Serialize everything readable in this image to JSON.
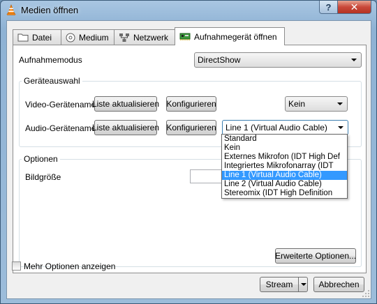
{
  "window": {
    "title": "Medien öffnen",
    "help_label": "?",
    "close_label": "✕"
  },
  "tabs": [
    {
      "label": "Datei",
      "icon": "folder-icon"
    },
    {
      "label": "Medium",
      "icon": "disc-icon"
    },
    {
      "label": "Netzwerk",
      "icon": "network-icon"
    },
    {
      "label": "Aufnahmegerät öffnen",
      "icon": "capture-card-icon",
      "active": true
    }
  ],
  "capture": {
    "mode_label": "Aufnahmemodus",
    "mode_value": "DirectShow"
  },
  "device_group": {
    "title": "Geräteauswahl",
    "video_label": "Video-Gerätename",
    "audio_label": "Audio-Gerätename",
    "refresh_label": "Liste aktualisieren",
    "configure_label": "Konfigurieren",
    "video_value": "Kein",
    "audio_value": "Line 1 (Virtual Audio Cable)",
    "audio_options": [
      "Standard",
      "Kein",
      "Externes Mikrofon (IDT High Def",
      "Integriertes Mikrofonarray (IDT",
      "Line 1 (Virtual Audio Cable)",
      "Line 2 (Virtual Audio Cable)",
      "Stereomix (IDT High Definition"
    ],
    "audio_selected_index": 4
  },
  "options_group": {
    "title": "Optionen",
    "picture_size_label": "Bildgröße",
    "advanced_label": "Erweiterte Optionen..."
  },
  "footer": {
    "more_options_label": "Mehr Optionen anzeigen",
    "stream_label": "Stream",
    "cancel_label": "Abbrechen"
  }
}
